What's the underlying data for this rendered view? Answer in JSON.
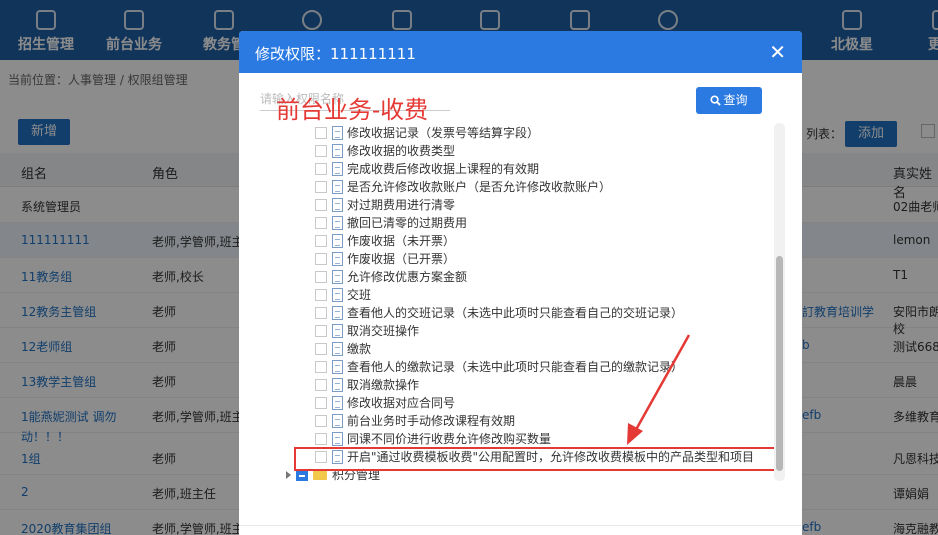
{
  "nav": {
    "items": [
      {
        "label": "招生管理",
        "icon": "user-add-icon"
      },
      {
        "label": "前台业务",
        "icon": "monitor-icon"
      },
      {
        "label": "教务管",
        "icon": "book-icon"
      },
      {
        "label": "",
        "icon": "user-icon"
      },
      {
        "label": "",
        "icon": "login-icon"
      },
      {
        "label": "",
        "icon": "home-icon"
      },
      {
        "label": "",
        "icon": "chart-icon"
      },
      {
        "label": "",
        "icon": "settings-icon"
      },
      {
        "label": "北极星",
        "icon": "star-gear-icon"
      },
      {
        "label": "更多",
        "icon": "grid-icon"
      }
    ]
  },
  "breadcrumb": "当前位置：人事管理 / 权限组管理",
  "toolbar": {
    "new_label": "新增",
    "list_label": "列表：",
    "add_label": "添加"
  },
  "table": {
    "headers": {
      "group": "组名",
      "role": "角色",
      "real_name": "真实姓名"
    },
    "rows": [
      {
        "name": "系统管理员",
        "role": "",
        "link": "",
        "real": "02曲老师"
      },
      {
        "name": "111111111",
        "role": "老师,学管师,班主",
        "link": "",
        "real": "lemon"
      },
      {
        "name": "11教务组",
        "role": "老师,校长",
        "link": "",
        "real": "T1"
      },
      {
        "name": "12教务主管组",
        "role": "老师",
        "link": "訂教育培训学",
        "real": "安阳市朗"
      },
      {
        "name": "",
        "role": "",
        "link": "",
        "real": "校"
      },
      {
        "name": "12老师组",
        "role": "老师",
        "link": "b",
        "real": "测试668"
      },
      {
        "name": "13教学主管组",
        "role": "老师",
        "link": "",
        "real": "晨晨"
      },
      {
        "name": "1能燕妮测试 调勿",
        "role": "老师,学管师,班主",
        "link": "efb",
        "real": "多维教育"
      },
      {
        "name": "动！！！",
        "role": "",
        "link": "",
        "real": ""
      },
      {
        "name": "1组",
        "role": "老师",
        "link": "",
        "real": "凡恩科技"
      },
      {
        "name": "2",
        "role": "老师,班主任",
        "link": "",
        "real": "谭娟娟"
      },
      {
        "name": "2020教育集团组",
        "role": "老师,学管师,班主",
        "link": "efb",
        "real": "海克融教"
      }
    ],
    "top_link": "kefb",
    "row2_link": "efb"
  },
  "dialog": {
    "title": "修改权限：111111111",
    "search_placeholder": "请输入权限名称",
    "query_label": "查询",
    "annotation": "前台业务-收费",
    "tree_items": [
      "修改收据记录（发票号等结算字段）",
      "修改收据的收费类型",
      "完成收费后修改收据上课程的有效期",
      "是否允许修改收款账户（是否允许修改收款账户）",
      "对过期费用进行清零",
      "撤回已清零的过期费用",
      "作废收据（未开票）",
      "作废收据（已开票）",
      "允许修改优惠方案金额",
      "交班",
      "查看他人的交班记录（未选中此项时只能查看自己的交班记录）",
      "取消交班操作",
      "缴款",
      "查看他人的缴款记录（未选中此项时只能查看自己的缴款记录）",
      "取消缴款操作",
      "修改收据对应合同号",
      "前台业务时手动修改课程有效期",
      "同课不同价进行收费允许修改购买数量",
      "开启\"通过收费模板收费\"公用配置时，允许修改收费模板中的产品类型和项目"
    ],
    "folder_label": "积分管理"
  }
}
